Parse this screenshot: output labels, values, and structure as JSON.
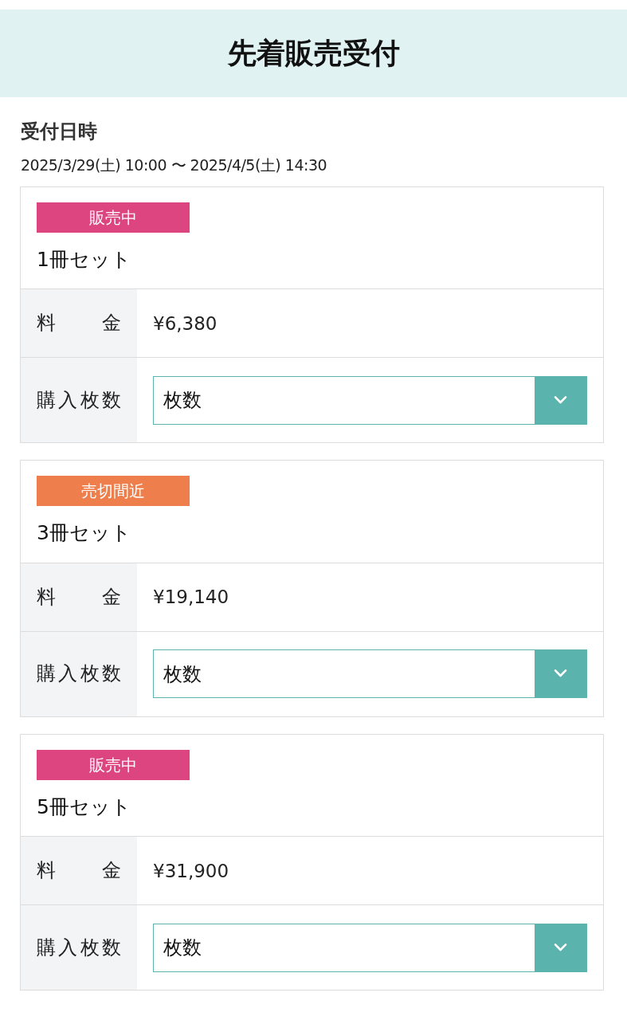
{
  "header": {
    "title": "先着販売受付"
  },
  "reception": {
    "heading": "受付日時",
    "period": "2025/3/29(土) 10:00 〜 2025/4/5(土) 14:30"
  },
  "items": [
    {
      "status": {
        "label": "販売中",
        "color": "#dc4580"
      },
      "name": "1冊セット",
      "price_label": "料　金",
      "price": "¥6,380",
      "quantity_label": "購入枚数",
      "quantity_select": {
        "placeholder": "枚数"
      }
    },
    {
      "status": {
        "label": "売切間近",
        "color": "#ee7f4c"
      },
      "name": "3冊セット",
      "price_label": "料　金",
      "price": "¥19,140",
      "quantity_label": "購入枚数",
      "quantity_select": {
        "placeholder": "枚数"
      }
    },
    {
      "status": {
        "label": "販売中",
        "color": "#dc4580"
      },
      "name": "5冊セット",
      "price_label": "料　金",
      "price": "¥31,900",
      "quantity_label": "購入枚数",
      "quantity_select": {
        "placeholder": "枚数"
      }
    }
  ]
}
